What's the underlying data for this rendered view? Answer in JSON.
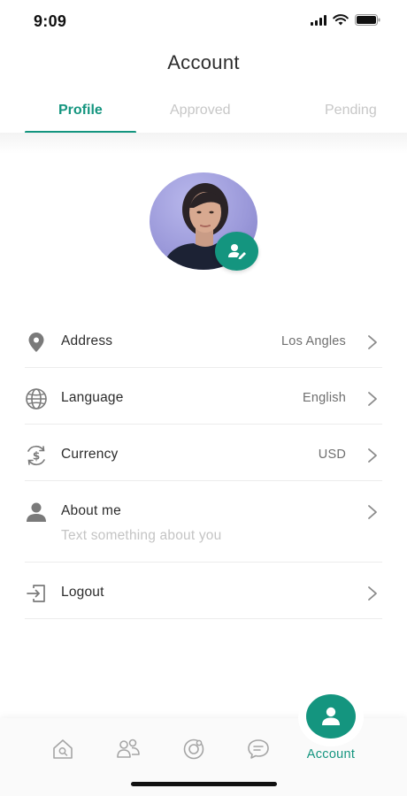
{
  "status_bar": {
    "time": "9:09"
  },
  "header": {
    "title": "Account"
  },
  "tabs": [
    {
      "label": "Profile",
      "active": true
    },
    {
      "label": "Approved",
      "active": false
    },
    {
      "label": "Pending",
      "active": false
    }
  ],
  "profile": {
    "avatar_icon": "person-photo",
    "edit_icon": "user-edit-icon"
  },
  "menu": [
    {
      "icon": "location-pin-icon",
      "label": "Address",
      "value": "Los Angles"
    },
    {
      "icon": "globe-icon",
      "label": "Language",
      "value": "English"
    },
    {
      "icon": "currency-exchange-icon",
      "label": "Currency",
      "value": "USD"
    },
    {
      "icon": "person-icon",
      "label": "About me",
      "subtitle": "Text something about you"
    },
    {
      "icon": "logout-icon",
      "label": "Logout"
    }
  ],
  "bottom_nav": {
    "items": [
      {
        "icon": "home-search-icon"
      },
      {
        "icon": "people-icon"
      },
      {
        "icon": "target-icon"
      },
      {
        "icon": "chat-icon"
      },
      {
        "icon": "account-icon",
        "label": "Account",
        "active": true
      }
    ]
  },
  "colors": {
    "accent": "#14957f",
    "muted_text": "#c4c4c4",
    "value_text": "#6f6f6f"
  }
}
